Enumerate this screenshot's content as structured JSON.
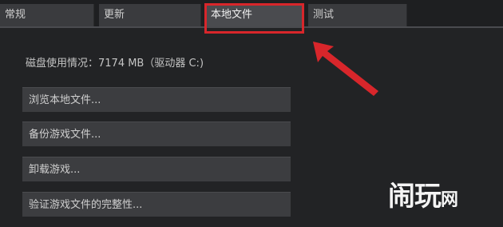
{
  "tabs": [
    {
      "label": "常规"
    },
    {
      "label": "更新"
    },
    {
      "label": "本地文件"
    },
    {
      "label": "测试"
    }
  ],
  "disk_usage": "磁盘使用情况：7174 MB（驱动器 C:)",
  "buttons": {
    "browse": "浏览本地文件...",
    "backup": "备份游戏文件...",
    "uninstall": "卸载游戏...",
    "verify": "验证游戏文件的完整性..."
  },
  "watermark": {
    "c1": "闹",
    "c2": "玩",
    "c3": "网"
  },
  "colors": {
    "highlight": "#d8262b",
    "background": "#1e1f21",
    "button": "#3c3d40"
  },
  "icons": {
    "annotation": "arrow-icon"
  }
}
